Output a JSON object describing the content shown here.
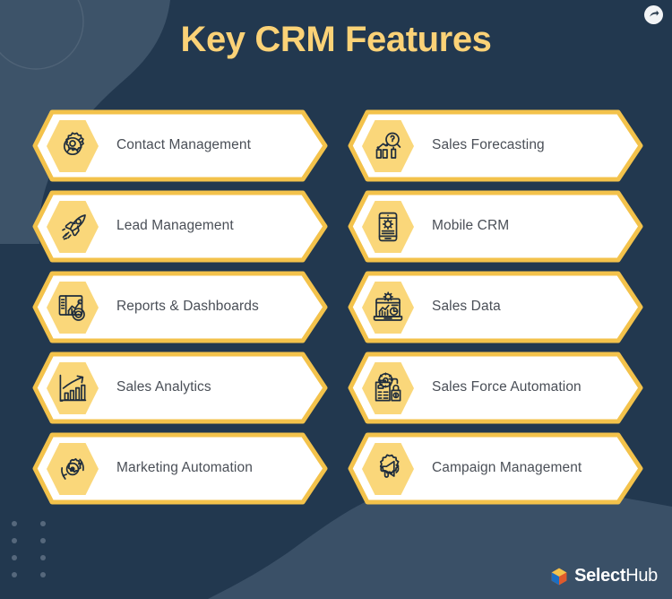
{
  "header": {
    "title": "Key CRM Features",
    "share_icon": "share-arrow-icon"
  },
  "theme": {
    "background": "#22384f",
    "background_wave": "#3d5369",
    "title_color": "#fbd277",
    "card_border": "#f3c24b",
    "card_fill": "#ffffff",
    "icon_badge_fill": "#fad77a",
    "icon_stroke": "#1f2d3d",
    "label_color": "#4a4f57",
    "dot_color": "#56687c"
  },
  "features": [
    {
      "label": "Contact Management",
      "icon": "gear-user-icon",
      "column": "left"
    },
    {
      "label": "Sales Forecasting",
      "icon": "chart-search-icon",
      "column": "right"
    },
    {
      "label": "Lead Management",
      "icon": "rocket-icon",
      "column": "left"
    },
    {
      "label": "Mobile CRM",
      "icon": "phone-gear-icon",
      "column": "right"
    },
    {
      "label": "Reports & Dashboards",
      "icon": "report-chart-icon",
      "column": "left"
    },
    {
      "label": "Sales Data",
      "icon": "dashboard-gear-icon",
      "column": "right"
    },
    {
      "label": "Sales Analytics",
      "icon": "growth-bars-icon",
      "column": "left"
    },
    {
      "label": "Sales Force Automation",
      "icon": "clipboard-money-icon",
      "column": "right"
    },
    {
      "label": "Marketing Automation",
      "icon": "gear-refresh-icon",
      "column": "left"
    },
    {
      "label": "Campaign Management",
      "icon": "gear-megaphone-icon",
      "column": "right"
    }
  ],
  "brand": {
    "name_strong": "Select",
    "name_light": "Hub",
    "mark_icon": "cube-logo-icon",
    "mark_colors": {
      "orange": "#f5803e",
      "blue": "#1b6ec2",
      "yellow": "#f3c24b",
      "red": "#e05a2b"
    }
  }
}
